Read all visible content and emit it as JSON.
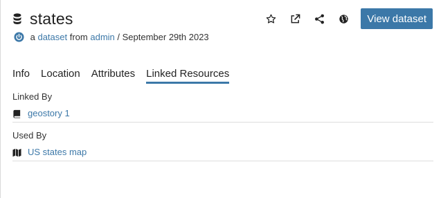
{
  "header": {
    "title": "states",
    "title_icon": "database-icon",
    "view_button_label": "View dataset",
    "action_icons": [
      "star-icon",
      "external-link-icon",
      "share-icon",
      "globe-icon"
    ]
  },
  "meta": {
    "prefix": " a ",
    "resource_type": "dataset",
    "from_text": " from ",
    "owner": "admin",
    "date_text": " / September 29th 2023"
  },
  "tabs": [
    {
      "label": "Info",
      "active": false
    },
    {
      "label": "Location",
      "active": false
    },
    {
      "label": "Attributes",
      "active": false
    },
    {
      "label": "Linked Resources",
      "active": true
    }
  ],
  "linked_by": {
    "label": "Linked By",
    "items": [
      {
        "label": "geostory 1",
        "icon": "book-icon"
      }
    ]
  },
  "used_by": {
    "label": "Used By",
    "items": [
      {
        "label": "US states map",
        "icon": "map-icon"
      }
    ]
  },
  "colors": {
    "accent": "#3c78a8",
    "text": "#333333",
    "divider": "#dedede"
  }
}
